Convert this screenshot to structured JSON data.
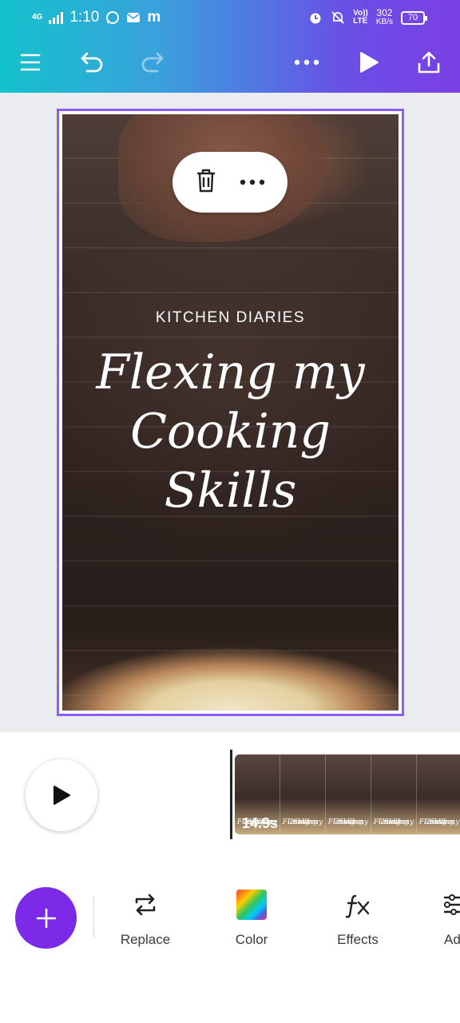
{
  "status_bar": {
    "network": "4G",
    "time": "1:10",
    "app_badge": "m",
    "volte_top": "Vo))",
    "volte_bottom": "LTE",
    "speed_value": "302",
    "speed_unit": "KB/s",
    "battery": "70"
  },
  "toolbar": {
    "icons": [
      "menu-icon",
      "undo-icon",
      "redo-icon",
      "more-icon",
      "play-icon",
      "share-icon"
    ]
  },
  "design": {
    "kicker": "KITCHEN DIARIES",
    "title_line1": "Flexing my",
    "title_line2": "Cooking",
    "title_line3": "Skills"
  },
  "context_menu": {
    "icons": [
      "trash-icon",
      "more-icon"
    ]
  },
  "timeline": {
    "duration": "14.9s",
    "thumb_text_1": "Flexing my",
    "thumb_text_2": "Cooking",
    "thumb_text_3": "Skills"
  },
  "bottom_tools": [
    {
      "label": "Replace",
      "icon": "replace-icon"
    },
    {
      "label": "Color",
      "icon": "color-icon"
    },
    {
      "label": "Effects",
      "icon": "effects-icon"
    },
    {
      "label": "Ad",
      "icon": "adjust-icon"
    }
  ],
  "colors": {
    "accent": "#7d2ae8",
    "selection": "#8b5cf6",
    "header_start": "#14c2cc",
    "header_end": "#7b3fe4"
  }
}
